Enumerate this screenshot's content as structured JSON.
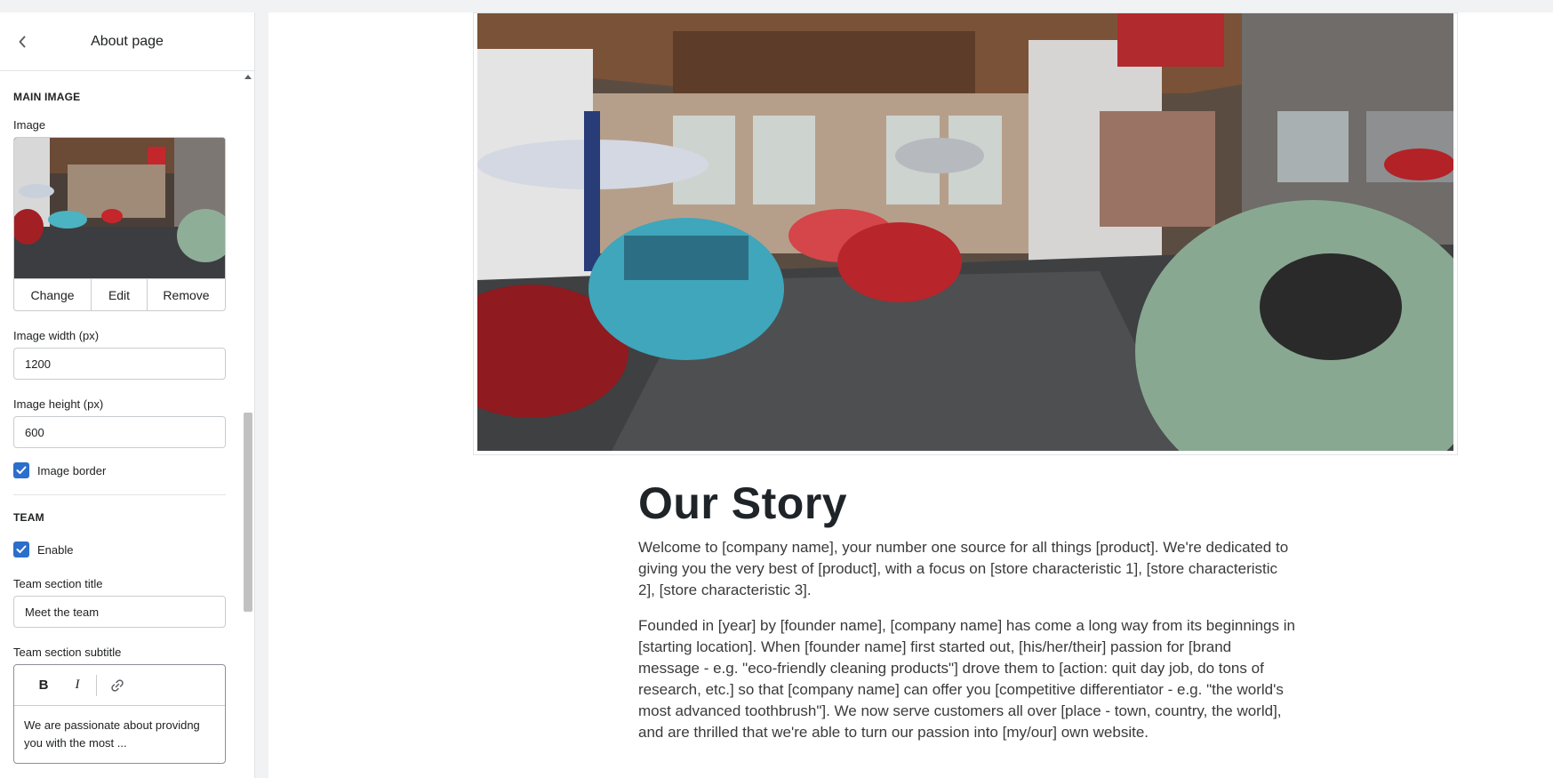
{
  "header": {
    "title": "About page"
  },
  "main_image": {
    "section_heading": "MAIN IMAGE",
    "image_label": "Image",
    "actions": [
      "Change",
      "Edit",
      "Remove"
    ],
    "width_label": "Image width (px)",
    "width_value": "1200",
    "height_label": "Image height (px)",
    "height_value": "600",
    "border_label": "Image border",
    "border_checked": true
  },
  "team": {
    "section_heading": "TEAM",
    "enable_label": "Enable",
    "enable_checked": true,
    "title_label": "Team section title",
    "title_value": "Meet the team",
    "subtitle_label": "Team section subtitle",
    "subtitle_toolbar": {
      "bold": "B",
      "italic": "I"
    },
    "subtitle_value": "We are passionate about providng you with the most ..."
  },
  "story": {
    "title": "Our Story",
    "paragraphs": [
      "Welcome to [company name], your number one source for all things [product]. We're dedicated to giving you the very best of [product], with a focus on [store characteristic 1], [store characteristic 2], [store characteristic 3].",
      "Founded in [year] by [founder name], [company name] has come a long way from its beginnings in [starting location]. When [founder name] first started out, [his/her/their] passion for [brand message - e.g. \"eco-friendly cleaning products\"] drove them to [action: quit day job, do tons of research, etc.] so that [company name] can offer you [competitive differentiator - e.g. \"the world's most advanced toothbrush\"]. We now serve customers all over [place - town, country, the world], and are thrilled that we're able to turn our passion into [my/our] own website."
    ]
  },
  "colors": {
    "accent": "#2c6ecb",
    "border": "#c9cccf",
    "panel_bg": "#f1f2f4"
  },
  "icons": [
    "chevron-left-icon",
    "check-icon",
    "link-icon",
    "cursor-icon"
  ]
}
